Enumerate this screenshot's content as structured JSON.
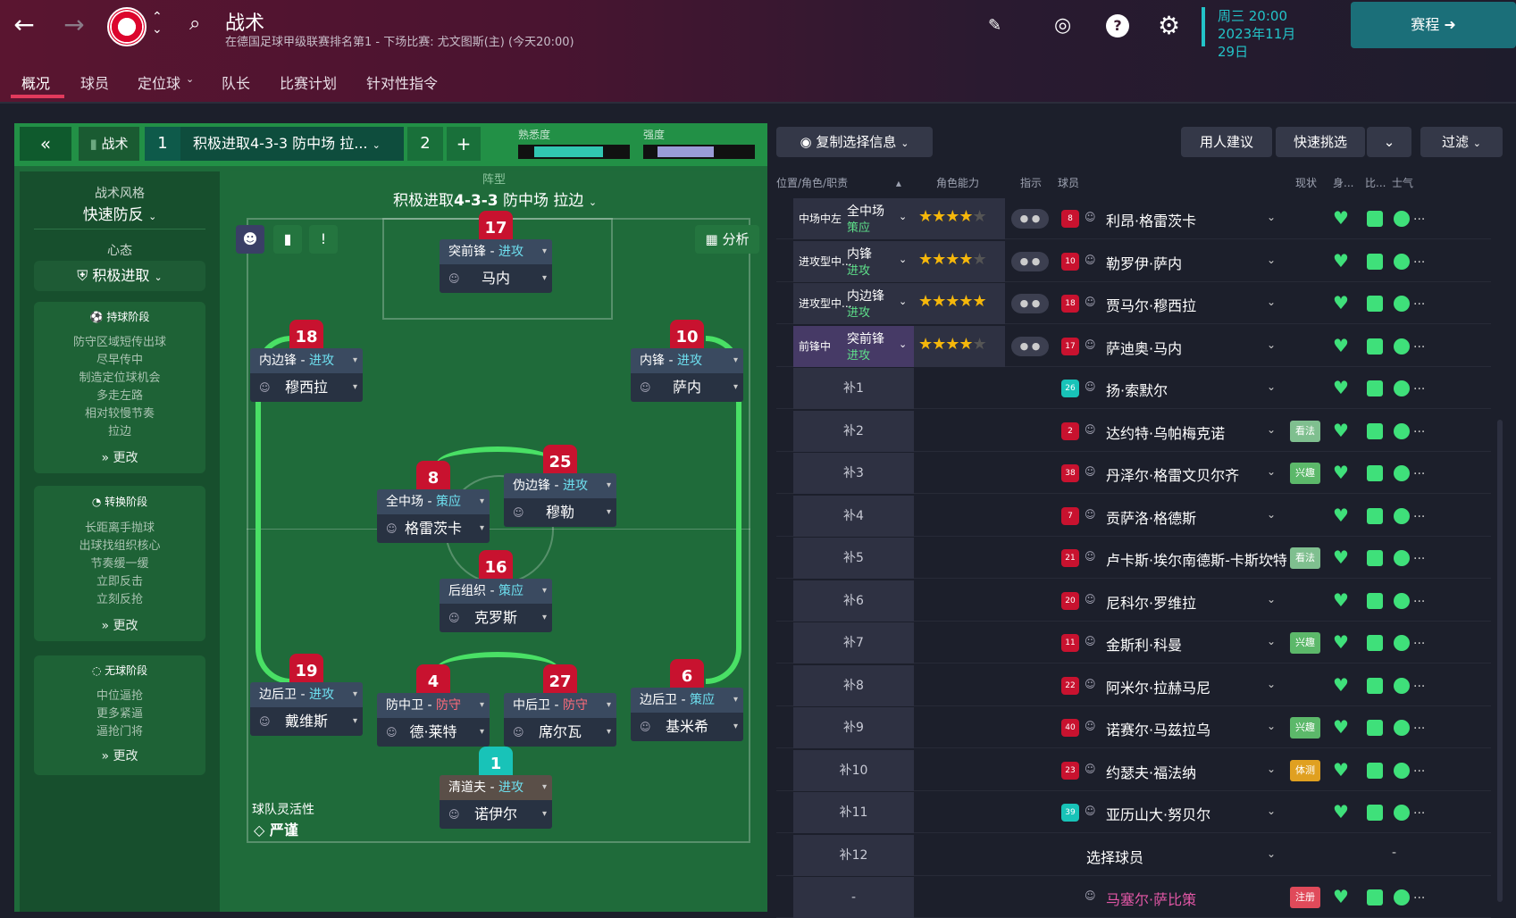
{
  "header": {
    "title": "战术",
    "subtitle": "在德国足球甲级联赛排名第1 - 下场比赛: 尤文图斯(主) (今天20:00)",
    "date_day": "周三 20:00",
    "date_full": "2023年11月29日",
    "schedule_label": "赛程"
  },
  "tabs": [
    "概况",
    "球员",
    "定位球",
    "队长",
    "比赛计划",
    "针对性指令"
  ],
  "tactic_bar": {
    "tactic_label": "战术",
    "slot1": "1",
    "tactic_name": "积极进取4-3-3 防中场 拉...",
    "slot2": "2",
    "add": "+",
    "familiarity_label": "熟悉度",
    "intensity_label": "强度",
    "familiarity_level": 0.7,
    "intensity_level": 0.6
  },
  "side_panel": {
    "style_label": "战术风格",
    "style_value": "快速防反",
    "mentality_label": "心态",
    "mentality_value": "积极进取",
    "in_possession": {
      "title": "持球阶段",
      "items": [
        "防守区域短传出球",
        "尽早传中",
        "制造定位球机会",
        "多走左路",
        "相对较慢节奏",
        "拉边"
      ],
      "change": "更改"
    },
    "transition": {
      "title": "转换阶段",
      "items": [
        "长距离手抛球",
        "出球找组织核心",
        "节奏缓一缓",
        "立即反击",
        "立刻反抢"
      ],
      "change": "更改"
    },
    "out_possession": {
      "title": "无球阶段",
      "items": [
        "中位逼抢",
        "更多紧逼",
        "逼抢门将"
      ],
      "change": "更改"
    }
  },
  "pitch": {
    "formation_label": "阵型",
    "formation_prefix": "积极进取",
    "formation_bold": "4-3-3",
    "formation_suffix": " 防中场 拉边",
    "analysis_label": "分析",
    "fluidity_label": "球队灵活性",
    "fluidity_value": "严谨"
  },
  "players_on_pitch": [
    {
      "num": "17",
      "role": "突前锋",
      "duty": "进攻",
      "name": "马内"
    },
    {
      "num": "18",
      "role": "内边锋",
      "duty": "进攻",
      "name": "穆西拉"
    },
    {
      "num": "10",
      "role": "内锋",
      "duty": "进攻",
      "name": "萨内"
    },
    {
      "num": "8",
      "role": "全中场",
      "duty": "策应",
      "name": "格雷茨卡"
    },
    {
      "num": "25",
      "role": "伪边锋",
      "duty": "进攻",
      "name": "穆勒"
    },
    {
      "num": "16",
      "role": "后组织",
      "duty": "策应",
      "name": "克罗斯"
    },
    {
      "num": "19",
      "role": "边后卫",
      "duty": "进攻",
      "name": "戴维斯"
    },
    {
      "num": "4",
      "role": "防中卫",
      "duty": "防守",
      "name": "德·莱特"
    },
    {
      "num": "27",
      "role": "中后卫",
      "duty": "防守",
      "name": "席尔瓦"
    },
    {
      "num": "6",
      "role": "边后卫",
      "duty": "策应",
      "name": "基米希"
    },
    {
      "num": "1",
      "role": "清道夫",
      "duty": "进攻",
      "name": "诺伊尔"
    }
  ],
  "right_panel": {
    "copy_btn": "复制选择信息",
    "suggest_btn": "用人建议",
    "quick_btn": "快速挑选",
    "filter_btn": "过滤",
    "col_pos": "位置/角色/职责",
    "col_ability": "角色能力",
    "col_instr": "指示",
    "col_player": "球员",
    "col_cond": "现状",
    "col_body": "身...",
    "col_match": "比...",
    "col_morale": "士气",
    "select_player": "选择球员",
    "dash": "-"
  },
  "rows": [
    {
      "pos": "中场中左",
      "role": "全中场",
      "duty": "策应",
      "stars": "★★★★",
      "dim": "★",
      "num": "8",
      "name": "利昂·格雷茨卡",
      "badge": "",
      "gk": false
    },
    {
      "pos": "进攻型中...",
      "role": "内锋",
      "duty": "进攻",
      "stars": "★★★★",
      "dim": "★",
      "num": "10",
      "name": "勒罗伊·萨内",
      "badge": "",
      "gk": false
    },
    {
      "pos": "进攻型中...",
      "role": "内边锋",
      "duty": "进攻",
      "stars": "★★★★★",
      "dim": "",
      "num": "18",
      "name": "贾马尔·穆西拉",
      "badge": "",
      "gk": false
    },
    {
      "pos": "前锋中",
      "role": "突前锋",
      "duty": "进攻",
      "stars": "★★★★",
      "dim": "★",
      "num": "17",
      "name": "萨迪奥·马内",
      "badge": "",
      "gk": false
    },
    {
      "pos": "补1",
      "num": "26",
      "name": "扬·索默尔",
      "badge": "",
      "gk": true
    },
    {
      "pos": "补2",
      "num": "2",
      "name": "达约特·乌帕梅克诺",
      "badge": "看法",
      "gk": false
    },
    {
      "pos": "补3",
      "num": "38",
      "name": "丹泽尔·格雷文贝尔齐",
      "badge": "兴趣",
      "gk": false
    },
    {
      "pos": "补4",
      "num": "7",
      "name": "贡萨洛·格德斯",
      "badge": "",
      "gk": false
    },
    {
      "pos": "补5",
      "num": "21",
      "name": "卢卡斯·埃尔南德斯-卡斯坎特",
      "badge": "看法",
      "gk": false
    },
    {
      "pos": "补6",
      "num": "20",
      "name": "尼科尔·罗维拉",
      "badge": "",
      "gk": false
    },
    {
      "pos": "补7",
      "num": "11",
      "name": "金斯利·科曼",
      "badge": "兴趣",
      "gk": false
    },
    {
      "pos": "补8",
      "num": "22",
      "name": "阿米尔·拉赫马尼",
      "badge": "",
      "gk": false
    },
    {
      "pos": "补9",
      "num": "40",
      "name": "诺赛尔·马兹拉乌",
      "badge": "兴趣",
      "gk": false
    },
    {
      "pos": "补10",
      "num": "23",
      "name": "约瑟夫·福法纳",
      "badge": "体测",
      "gk": false
    },
    {
      "pos": "补11",
      "num": "39",
      "name": "亚历山大·努贝尔",
      "badge": "",
      "gk": true
    },
    {
      "pos": "补12",
      "num": "",
      "name": "",
      "badge": "",
      "gk": false
    },
    {
      "pos": "-",
      "num": "",
      "name": "马塞尔·萨比策",
      "badge": "注册",
      "gk": false
    }
  ],
  "colors": {
    "accent": "#23c3c8",
    "team": "#c8122f",
    "pitch": "#1f6b3a",
    "good": "#3fe07a"
  }
}
